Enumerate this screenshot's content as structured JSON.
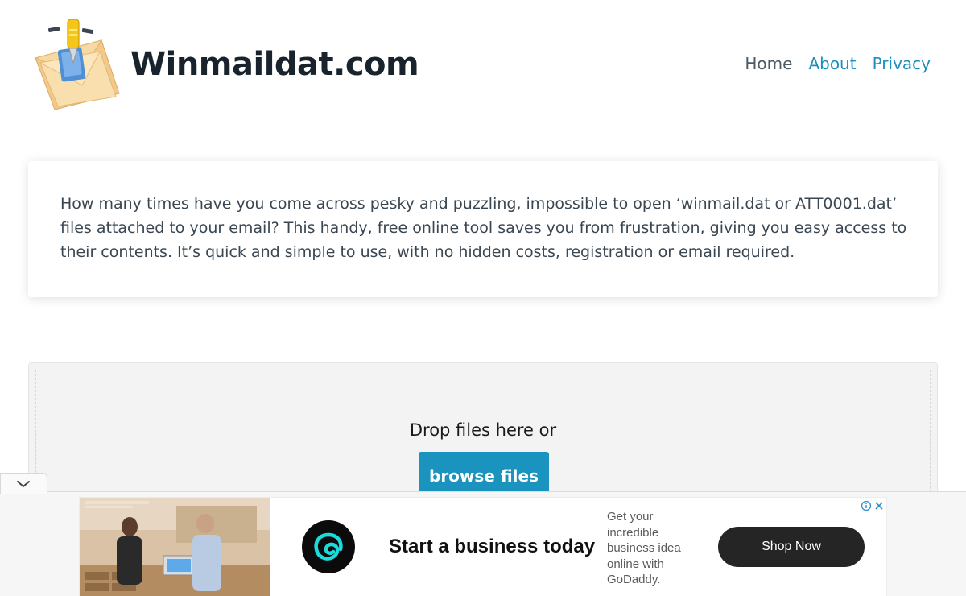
{
  "header": {
    "site_title": "Winmaildat.com",
    "nav": [
      {
        "label": "Home"
      },
      {
        "label": "About"
      },
      {
        "label": "Privacy"
      }
    ]
  },
  "intro": {
    "text": "How many times have you come across pesky and puzzling, impossible to open ‘winmail.dat or ATT0001.dat’ files attached to your email? This handy, free online tool saves you from frustration, giving you easy access to their contents. It’s quick and simple to use, with no hidden costs, registration or email required."
  },
  "upload": {
    "drop_text": "Drop files here or",
    "browse_label": "browse files"
  },
  "ad": {
    "headline": "Start a business today",
    "body": "Get your incredible business idea online with GoDaddy.",
    "cta": "Shop Now",
    "icons": [
      "ad-info-icon",
      "ad-close-icon"
    ]
  },
  "icons": {
    "collapse": "chevron-down-icon",
    "logo": "envelope-pen-logo",
    "ad_logo": "godaddy-logo"
  },
  "colors": {
    "accent": "#1a93bf",
    "nav_link": "#1c8fbd",
    "title": "#18232d",
    "cta": "#252525"
  }
}
